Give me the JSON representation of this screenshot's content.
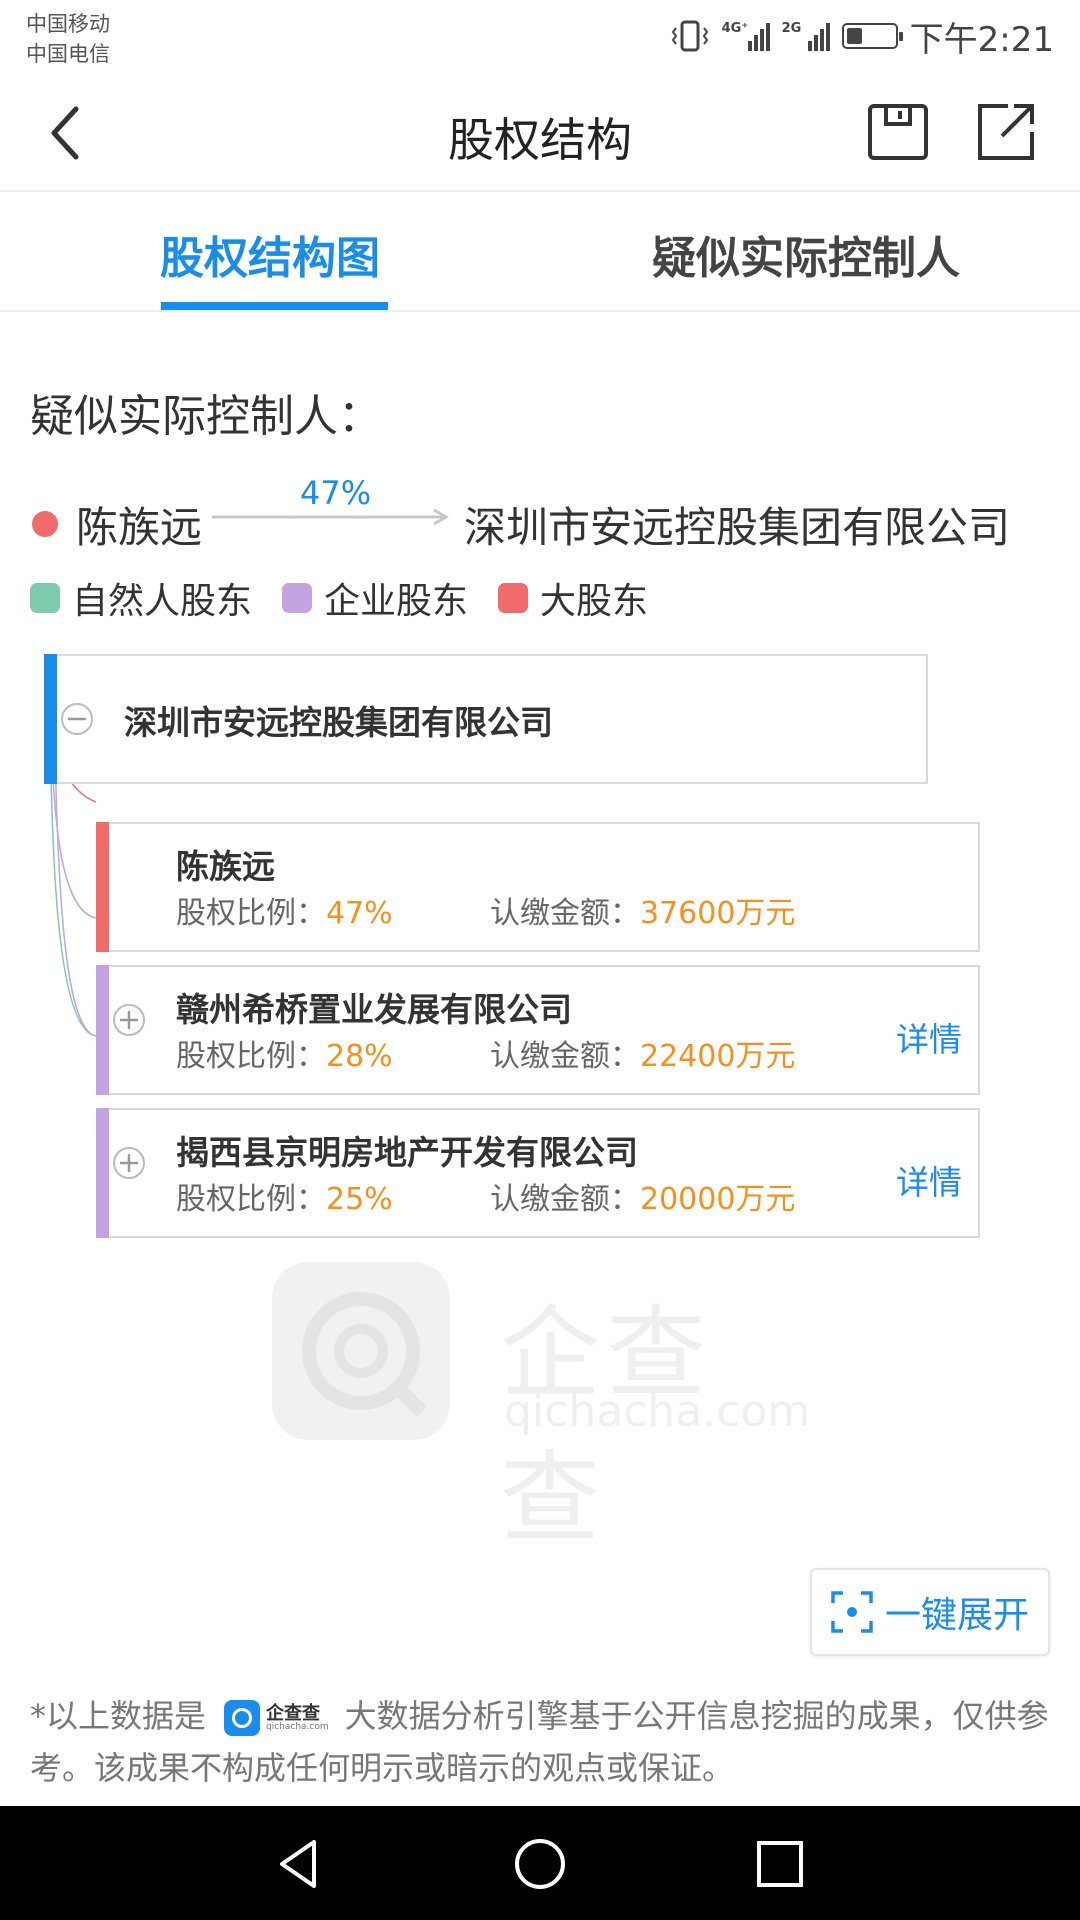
{
  "status_bar": {
    "carrier1": "中国移动",
    "carrier2": "中国电信",
    "signal1_label": "4G⁺",
    "signal2_label": "2G",
    "battery_level": 0.3,
    "time": "下午2:21"
  },
  "header": {
    "title": "股权结构",
    "back_icon": "chevron-left-icon",
    "save_icon": "save-icon",
    "share_icon": "share-icon"
  },
  "tabs": [
    {
      "label": "股权结构图",
      "active": true
    },
    {
      "label": "疑似实际控制人",
      "active": false
    }
  ],
  "controller": {
    "section_title": "疑似实际控制人：",
    "person": "陈族远",
    "percent": "47%",
    "company": "深圳市安远控股集团有限公司"
  },
  "legend": [
    {
      "label": "自然人股东",
      "color": "#7ecbab"
    },
    {
      "label": "企业股东",
      "color": "#c3a3e0"
    },
    {
      "label": "大股东",
      "color": "#f26b6b"
    }
  ],
  "tree": {
    "root": {
      "name": "深圳市安远控股集团有限公司",
      "color": "#1a8ceb",
      "toggle_icon": "collapse-minus-icon"
    },
    "ratio_label": "股权比例：",
    "amount_label": "认缴金额：",
    "children": [
      {
        "name": "陈族远",
        "ratio": "47%",
        "amount": "37600万元",
        "color": "#f26b6b",
        "detail": ""
      },
      {
        "name": "赣州希桥置业发展有限公司",
        "ratio": "28%",
        "amount": "22400万元",
        "color": "#c3a3e0",
        "detail": "详情",
        "toggle_icon": "expand-plus-icon"
      },
      {
        "name": "揭西县京明房地产开发有限公司",
        "ratio": "25%",
        "amount": "20000万元",
        "color": "#c3a3e0",
        "detail": "详情",
        "toggle_icon": "expand-plus-icon"
      }
    ]
  },
  "watermark": {
    "text": "企查查",
    "url": "qichacha.com"
  },
  "expand_button": {
    "label": "一键展开",
    "icon": "focus-frame-icon"
  },
  "disclaimer": {
    "prefix": "*以上数据是",
    "logo_text": "企查查",
    "logo_sub": "qichacha.com",
    "suffix": "大数据分析引擎基于公开信息挖掘的成果，仅供参考。该成果不构成任何明示或暗示的观点或保证。"
  },
  "navbar": {
    "back": "nav-back-icon",
    "home": "nav-home-icon",
    "recent": "nav-recent-icon"
  }
}
